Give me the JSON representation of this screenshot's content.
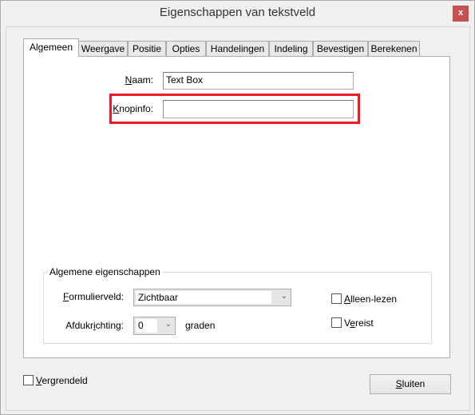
{
  "window": {
    "title": "Eigenschappen van tekstveld",
    "close": "x"
  },
  "tabs": [
    {
      "label": "Algemeen"
    },
    {
      "label": "Weergave"
    },
    {
      "label": "Positie"
    },
    {
      "label": "Opties"
    },
    {
      "label": "Handelingen"
    },
    {
      "label": "Indeling"
    },
    {
      "label": "Bevestigen"
    },
    {
      "label": "Berekenen"
    }
  ],
  "fields": {
    "naam": {
      "pre": "",
      "key": "N",
      "post": "aam:",
      "value": "Text Box"
    },
    "knopinfo": {
      "pre": "",
      "key": "K",
      "post": "nopinfo:",
      "value": ""
    }
  },
  "group": {
    "legend": "Algemene eigenschappen",
    "formulierveld": {
      "pre": "",
      "key": "F",
      "post": "ormulierveld:",
      "value": "Zichtbaar"
    },
    "afdrukrichting": {
      "pre": "Afdukr",
      "key": "i",
      "post": "chting:",
      "value": "0",
      "unit": "graden"
    },
    "alleen_lezen": {
      "pre": "",
      "key": "A",
      "post": "lleen-lezen",
      "checked": false
    },
    "vereist": {
      "pre": "V",
      "key": "e",
      "post": "reist",
      "checked": false
    }
  },
  "vergrendeld": {
    "pre": "",
    "key": "V",
    "post": "ergrendeld",
    "checked": false
  },
  "sluiten": {
    "pre": "",
    "key": "S",
    "post": "luiten"
  },
  "highlight_color": "#ed1c24"
}
